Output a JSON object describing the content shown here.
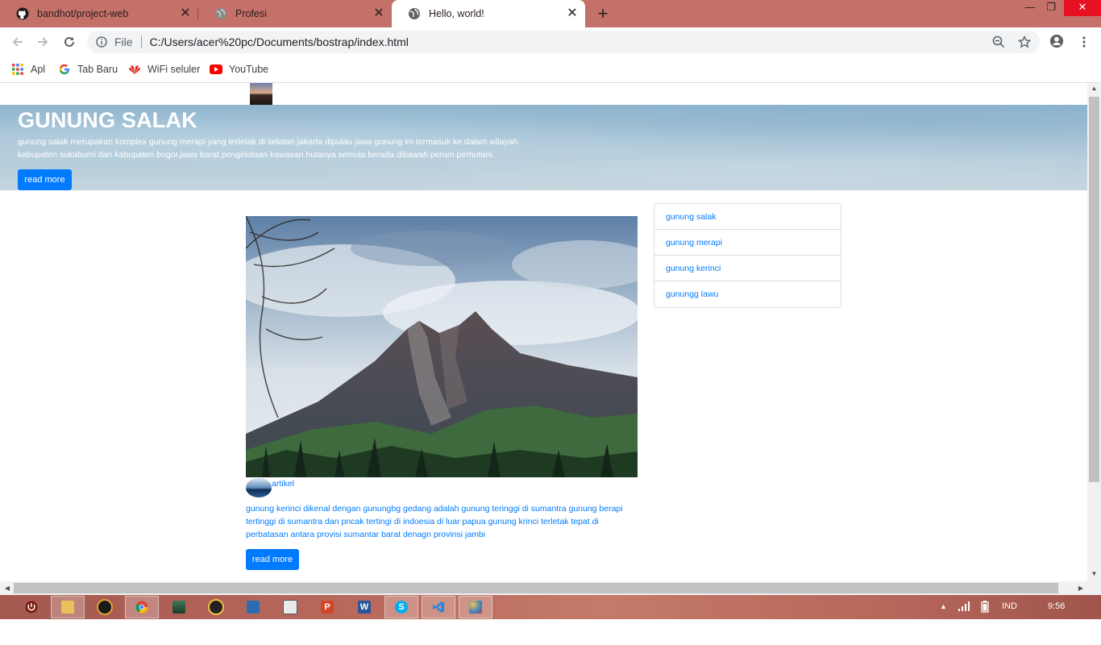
{
  "browser": {
    "tabs": [
      {
        "title": "bandhot/project-web",
        "icon": "github-icon",
        "active": false
      },
      {
        "title": "Profesi",
        "icon": "globe-icon",
        "active": false
      },
      {
        "title": "Hello, world!",
        "icon": "globe-icon",
        "active": true
      }
    ],
    "new_tab_label": "+",
    "address": {
      "scheme": "File",
      "url": "C:/Users/acer%20pc/Documents/bostrap/index.html"
    },
    "bookmarks": [
      {
        "label": "Apl",
        "icon": "apps-grid-icon"
      },
      {
        "label": "Tab Baru",
        "icon": "google-icon"
      },
      {
        "label": "WiFi seluler",
        "icon": "huawei-icon"
      },
      {
        "label": "YouTube",
        "icon": "youtube-icon"
      }
    ]
  },
  "page": {
    "jumbotron": {
      "title": "GUNUNG SALAK",
      "text": "gunung salak merupakan komplex gunung merapi yang terletak di selatan jakarta dipulau jawa gunung ini termasuk ke dalam wilayah kabupaten sukabumi dan kabupaten bogor,jawa barat pengelolaan kawasan hutanya semula berada dibawah perum perhutani.",
      "button": "read more"
    },
    "article": {
      "label": "artikel",
      "text": "gunung kerinci dikenal dengan gunungbg gedang adalah gunung teringgi di sumantra gunung berapi tertinggi di sumantra dan pncak tertingi di indoesia di luar papua gunung krinci terletak tepat di perbatasan antara provisi sumantar barat denagn provinsi jambi",
      "button": "read more"
    },
    "sidebar": {
      "items": [
        "gunung salak",
        "gunung merapi",
        "gunung kerinci",
        "gunungg lawu"
      ]
    }
  },
  "taskbar": {
    "language": "IND",
    "time": "9:56"
  },
  "colors": {
    "tab_strip": "#c4716a",
    "primary": "#007bff",
    "link": "#007bff"
  }
}
